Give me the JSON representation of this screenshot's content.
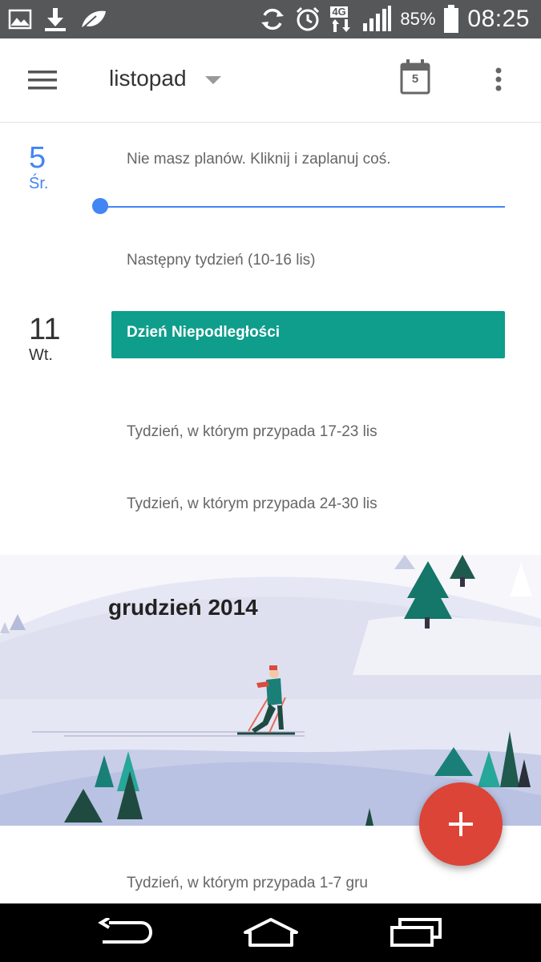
{
  "status_bar": {
    "battery_percent": "85%",
    "time": "08:25",
    "network_type": "4G",
    "icons": [
      "image-icon",
      "download-icon",
      "leaf-icon",
      "sync-icon",
      "alarm-icon",
      "network-4g-icon",
      "signal-icon",
      "battery-icon"
    ]
  },
  "app_bar": {
    "title": "listopad",
    "today_badge": "5",
    "icons": [
      "menu-icon",
      "dropdown-caret-icon",
      "calendar-today-icon",
      "more-vert-icon"
    ]
  },
  "schedule": {
    "today": {
      "day": "5",
      "weekday": "Śr.",
      "message": "Nie masz planów. Kliknij i zaplanuj coś."
    },
    "week1": "Następny tydzień (10-16 lis)",
    "day11": {
      "day": "11",
      "weekday": "Wt.",
      "event": "Dzień Niepodległości"
    },
    "week2": "Tydzień, w którym przypada 17-23 lis",
    "week3": "Tydzień, w którym przypada 24-30 lis",
    "month_banner": "grudzień 2014",
    "week4": "Tydzień, w którym przypada 1-7 gru"
  },
  "colors": {
    "accent_blue": "#4285f4",
    "event_teal": "#0f9d8c",
    "fab_red": "#db4437"
  },
  "nav_bar": {
    "icons": [
      "back-icon",
      "home-icon",
      "recents-icon"
    ]
  }
}
